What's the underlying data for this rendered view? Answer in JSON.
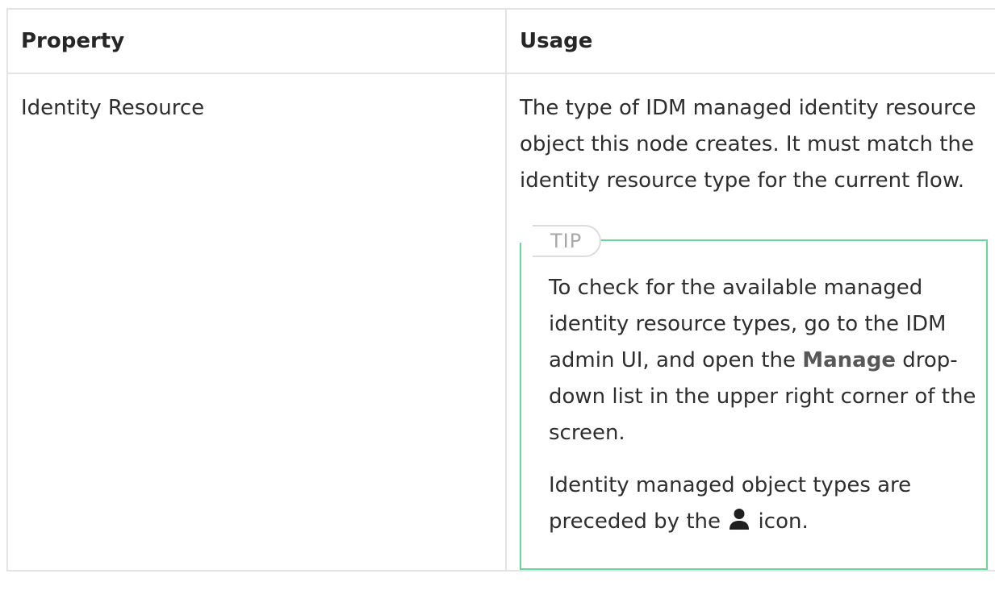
{
  "table": {
    "headers": [
      "Property",
      "Usage"
    ],
    "rows": [
      {
        "property": "Identity Resource",
        "usage": "The type of IDM managed identity resource object this node creates. It must match the identity resource type for the current flow.",
        "tip": {
          "label": "TIP",
          "p1_before": "To check for the available managed identity resource types, go to the IDM admin UI, and open the ",
          "p1_bold": "Manage",
          "p1_after": " drop-down list in the upper right corner of the screen.",
          "p2_before": "Identity managed object types are preceded by the ",
          "p2_icon": "person-icon",
          "p2_after": " icon."
        }
      }
    ]
  },
  "colors": {
    "tip_border": "#66d69a",
    "table_border": "#e3e3e3"
  }
}
